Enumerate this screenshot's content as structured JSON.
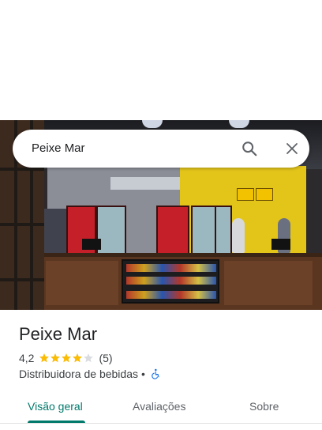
{
  "search": {
    "query": "Peixe Mar",
    "search_icon": "search-icon",
    "close_icon": "close-icon"
  },
  "photo": {
    "description_icon": "storefront-photo"
  },
  "place": {
    "name": "Peixe Mar",
    "rating": "4,2",
    "rating_value": 4.2,
    "stars_max": 5,
    "review_count": "(5)",
    "category": "Distribuidora de bebidas",
    "separator": "•",
    "accessibility_icon": "wheelchair-icon"
  },
  "tabs": [
    {
      "label": "Visão geral",
      "active": true
    },
    {
      "label": "Avaliações",
      "active": false
    },
    {
      "label": "Sobre",
      "active": false
    }
  ],
  "colors": {
    "accent": "#00796b",
    "star_filled": "#fbbc04",
    "star_empty": "#dadce0",
    "accessibility": "#1a73e8"
  }
}
